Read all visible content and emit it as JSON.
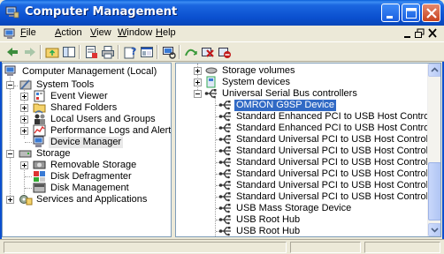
{
  "window": {
    "title": "Computer Management"
  },
  "menu": [
    {
      "label": "File",
      "u": "F",
      "rest": "ile"
    },
    {
      "label": "Action",
      "u": "A",
      "rest": "ction"
    },
    {
      "label": "View",
      "u": "V",
      "rest": "iew"
    },
    {
      "label": "Window",
      "u": "W",
      "rest": "indow"
    },
    {
      "label": "Help",
      "u": "H",
      "rest": "elp"
    }
  ],
  "left_tree": [
    "Computer Management (Local)",
    "System Tools",
    "Event Viewer",
    "Shared Folders",
    "Local Users and Groups",
    "Performance Logs and Alerts",
    "Device Manager",
    "Storage",
    "Removable Storage",
    "Disk Defragmenter",
    "Disk Management",
    "Services and Applications"
  ],
  "right_tree": [
    "Storage volumes",
    "System devices",
    "Universal Serial Bus controllers",
    "OMRON G9SP Device",
    "Standard Enhanced PCI to USB Host Controller",
    "Standard Enhanced PCI to USB Host Controller",
    "Standard Universal PCI to USB Host Controller",
    "Standard Universal PCI to USB Host Controller",
    "Standard Universal PCI to USB Host Controller",
    "Standard Universal PCI to USB Host Controller",
    "Standard Universal PCI to USB Host Controller",
    "Standard Universal PCI to USB Host Controller",
    "USB Mass Storage Device",
    "USB Root Hub",
    "USB Root Hub"
  ],
  "colors": {
    "title_bar": "#0a4fcf",
    "selection": "#316ac5",
    "chrome": "#ece9d8"
  },
  "icons": {
    "toolbar": [
      "back-arrow-icon",
      "forward-arrow-icon",
      "up-folder-icon",
      "show-tree-icon",
      "properties-icon",
      "print-icon",
      "help-icon",
      "console-tree-icon",
      "scan-hardware-icon",
      "update-driver-icon",
      "uninstall-icon",
      "disable-icon"
    ]
  }
}
